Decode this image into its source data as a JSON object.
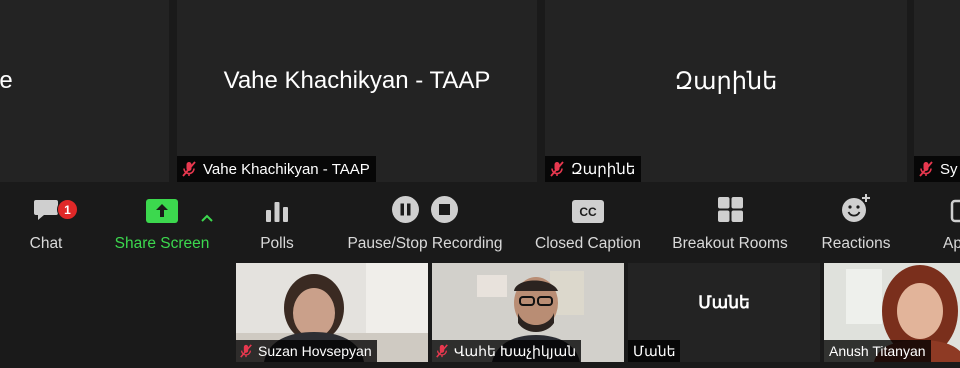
{
  "tiles": [
    {
      "display_name": "ne",
      "tag_name": ""
    },
    {
      "display_name": "Vahe Khachikyan - TAAP",
      "tag_name": "Vahe Khachikyan - TAAP"
    },
    {
      "display_name": "Զարինե",
      "tag_name": "Զարինե"
    },
    {
      "display_name": "",
      "tag_name": "Sy"
    }
  ],
  "toolbar": {
    "chat": {
      "label": "Chat",
      "badge": "1"
    },
    "share_screen": {
      "label": "Share Screen"
    },
    "polls": {
      "label": "Polls"
    },
    "recording": {
      "label": "Pause/Stop Recording"
    },
    "closed_caption": {
      "label": "Closed Caption",
      "icon_text": "CC"
    },
    "breakout_rooms": {
      "label": "Breakout Rooms"
    },
    "reactions": {
      "label": "Reactions"
    },
    "apps": {
      "label": "Ap"
    }
  },
  "thumbnails": [
    {
      "name": "Suzan Hovsepyan"
    },
    {
      "name": "Վահե Խաչիկյան"
    },
    {
      "name": "Մանե",
      "display_name": "Մանե"
    },
    {
      "name": "Anush Titanyan"
    }
  ],
  "colors": {
    "accent_green": "#3cd84e",
    "badge_red": "#e02828",
    "muted_red": "#e8384f"
  }
}
